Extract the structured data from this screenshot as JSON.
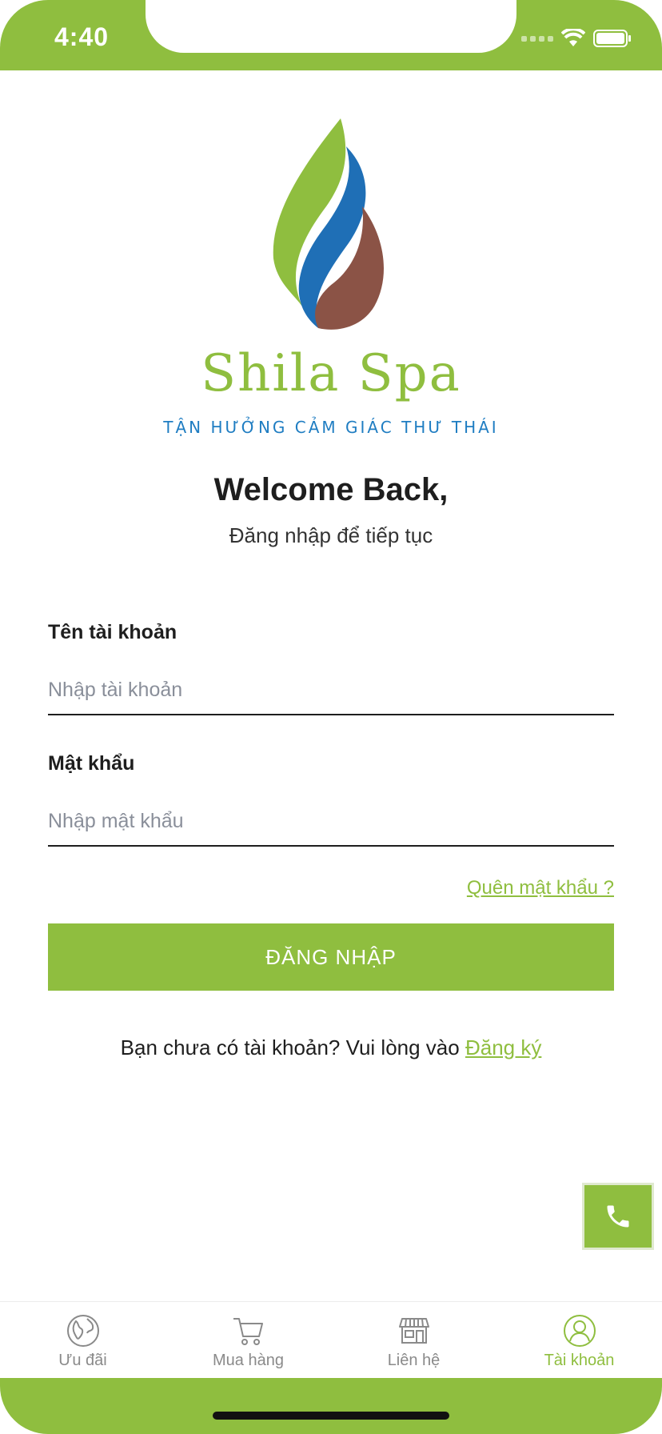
{
  "status_bar": {
    "time": "4:40",
    "icons": [
      "signal-icon",
      "wifi-icon",
      "battery-icon"
    ]
  },
  "brand": {
    "name": "Shila Spa",
    "tagline": "TẬN HƯỞNG CẢM GIÁC THƯ THÁI"
  },
  "welcome": {
    "title": "Welcome Back,",
    "subtitle": "Đăng nhập để tiếp tục"
  },
  "form": {
    "username_label": "Tên tài khoản",
    "username_placeholder": "Nhập tài khoản",
    "username_value": "",
    "password_label": "Mật khẩu",
    "password_placeholder": "Nhập mật khẩu",
    "password_value": "",
    "forgot_link": "Quên mật khẩu ?",
    "login_button": "ĐĂNG NHẬP",
    "signup_prompt": "Bạn chưa có tài khoản? Vui lòng vào ",
    "signup_link": "Đăng ký"
  },
  "fab": {
    "icon": "phone-icon"
  },
  "tab_bar": {
    "active": "Tài khoản",
    "items": [
      {
        "label": "Ưu đãi",
        "icon": "globe-icon"
      },
      {
        "label": "Mua hàng",
        "icon": "cart-icon"
      },
      {
        "label": "Liên hệ",
        "icon": "store-icon"
      },
      {
        "label": "Tài khoản",
        "icon": "user-icon"
      }
    ]
  },
  "colors": {
    "brand_green": "#8fbe3f",
    "brand_blue": "#1f7dc2",
    "brand_brown": "#8b5346",
    "text_dark": "#1e1e1e",
    "placeholder_gray": "#8a8f9a"
  }
}
